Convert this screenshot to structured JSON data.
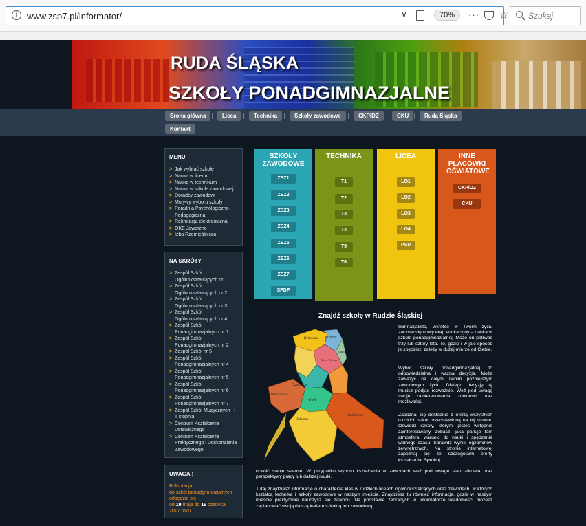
{
  "browser": {
    "url": "www.zsp7.pl/informator/",
    "zoom": "70%",
    "search_placeholder": "Szukaj"
  },
  "banner": {
    "line1": "RUDA ŚLĄSKA",
    "line2": "SZKOŁY PONADGIMNAZJALNE"
  },
  "nav": {
    "items": [
      "Srona główna",
      "Licea",
      "Technika",
      "Szkoły zawodowe",
      "CKPiDZ",
      "CKU",
      "Ruda Śląska",
      "Kontakt"
    ]
  },
  "menu": {
    "title": "MENU",
    "items": [
      "Jak wybrać szkołę",
      "Nauka w liceum",
      "Nauka w technikum",
      "Nauka w szkole zawodowej",
      "Doradcy zawodowi",
      "Motywy wyboru szkoły",
      "Poradnia Psychologiczno-Pedagogiczna",
      "Rekrutacja elektroniczna",
      "OKE Jaworzno",
      "Izba Rzemieślnicza"
    ]
  },
  "shortcuts": {
    "title": "NA SKRÓTY",
    "items": [
      "Zespół Szkół Ogólnokształcących nr 1",
      "Zespół Szkół Ogólnokształcących nr 2",
      "Zespół Szkół Ogólnokształcących nr 3",
      "Zespół Szkół Ogólnokształcących nr 4",
      "Zespół Szkół Ponadgimnazjalnych nr 1",
      "Zespół Szkół Ponadgimnazjalnych nr 2",
      "Zespół Szkół nr 5",
      "Zespół Szkół Ponadgimnazjalnych nr 4",
      "Zespół Szkół Ponadgimnazjalnych nr 5",
      "Zespół Szkół Ponadgimnazjalnych nr 6",
      "Zespół Szkół Ponadgimnazjalnych nr 7",
      " Zespół Szkół Muzycznych I i II stopnia",
      "Centrum Kształcenia Ustawicznego",
      "Centrum Kształcenia Praktycznego i Doskonalenia Zawodowego"
    ]
  },
  "notice": {
    "title": "UWAGA !",
    "line1": "Rekrutacja",
    "line2": "do szkół ponadgimnazjalnych",
    "line3": "odbędzie się",
    "line4_pre": "od ",
    "date_from_day": "19",
    "line4_mid1": " maja do ",
    "date_to_day": "19",
    "line4_mid2": " czerwca",
    "line5": "2017 roku."
  },
  "columns": [
    {
      "title": "SZKOŁY ZAWODOWE",
      "color": "#2aa6b5",
      "buttons": [
        "ZSZ1",
        "ZSZ2",
        "ZSZ3",
        "ZSZ4",
        "ZSZ5",
        "ZSZ6",
        "ZSZ7",
        "SPDP"
      ]
    },
    {
      "title": "TECHNIKA",
      "color": "#7c9518",
      "buttons": [
        "T1",
        "T2",
        "T3",
        "T4",
        "T5",
        "T6"
      ]
    },
    {
      "title": "LICEA",
      "color": "#f1c410",
      "buttons": [
        "LO1",
        "LO2",
        "LO3",
        "LO4",
        "PSM"
      ]
    },
    {
      "title": "INNE PLACÓWKI OŚWIATOWE",
      "color": "#d8571a",
      "buttons": [
        "CKPiDZ",
        "CKU"
      ]
    }
  ],
  "main": {
    "heading": "Znajdź szkołę w Rudzie Śląskiej",
    "map_labels": [
      "Bykowina",
      "Orzegów",
      "Nowy Bytom",
      "Chebzie",
      "Czarny Las",
      "Bielszowice",
      "Wirek",
      "Halemba",
      "Kochłowice"
    ],
    "p1": "Gimnazjalisto, wkrótce w Twoim życiu zacznie się nowy etap edukacyjny – nauka w szkole ponadgimnazjalnej. Może on potrwać trzy lub cztery lata. To, gdzie i w jaki sposób je spędzisz, zależy w dużej mierze od Ciebie.",
    "p2": "Wybór szkoły ponadgimnazjalnej to odpowiedzialna i ważna decyzja. Może zaważyć na całym Twoim późniejszym zawodowym życiu. Dlatego decyzję tę musisz podjąć rozważnie. Weź pod uwagę swoje zainteresowania, zdolności oraz możliwości.",
    "p3": "Zapoznaj się dokładnie z ofertą wszystkich rudzkich szkół przedstawioną na tej stronie. Odwiedź szkoły, którymi jesteś wstępnie zainteresowany, zobacz, jaka panuje tam atmosfera, warunki do nauki i spędzania wolnego czasu. Sprawdź wyniki egzaminów zewnętrznych. Na stronie internetowej zapoznaj się ze szczegółami oferty kształcenia. Spróbuj",
    "p4": "ocenić swoje szanse. W przypadku wyboru kształcenia w zawodach weź pod uwagę stan zdrowia oraz perspektywy pracy lub dalszej nauki.",
    "p5": "Tutaj znajdziesz informacje o charakterze klas w rudzkich liceach ogólnokształcących oraz zawodach, w których kształcą technika i szkoły zawodowe w naszym mieście. Znajdziesz tu również informacje, gdzie w naszym mieście praktycznie nauczysz się zawodu. Na podstawie zebranych w informatorze wiadomości możesz zaplanować swoją dalszą karierę szkolną lub zawodową."
  }
}
